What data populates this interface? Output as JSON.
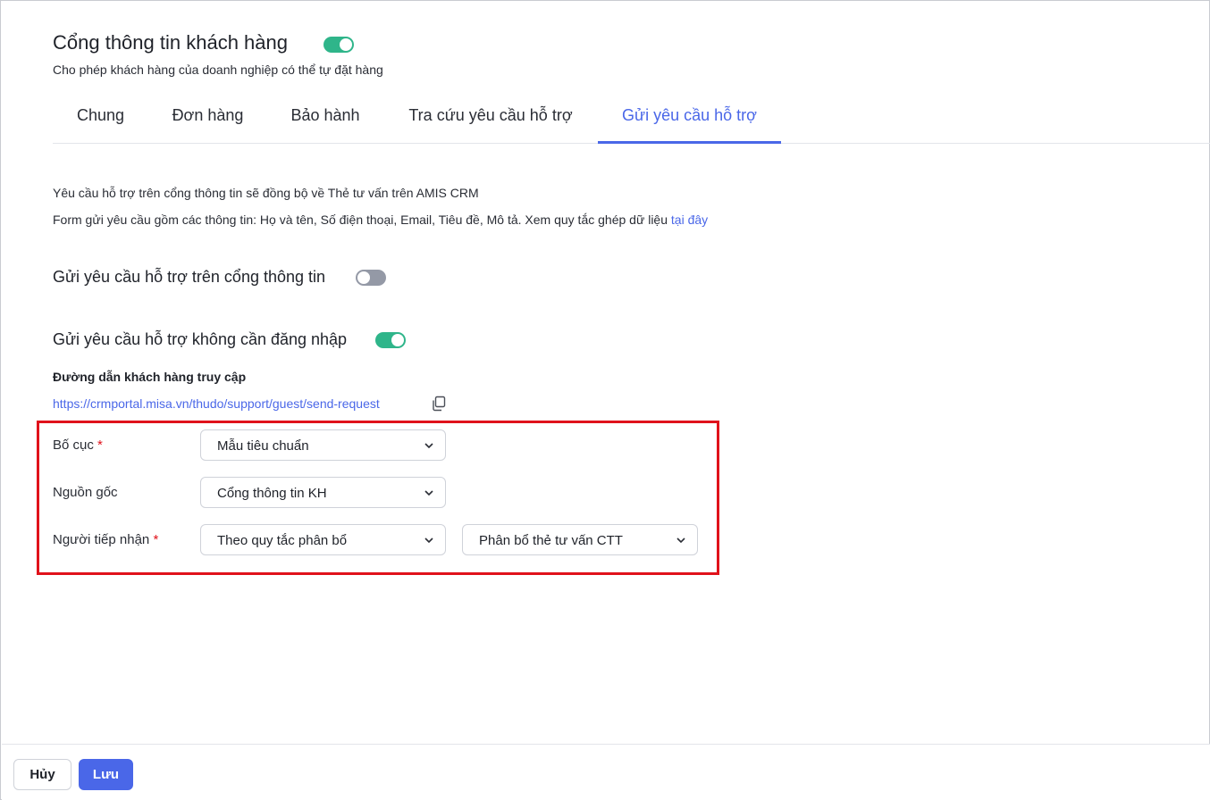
{
  "header": {
    "title": "Cổng thông tin khách hàng",
    "toggle_on": true,
    "subtitle": "Cho phép khách hàng của doanh nghiệp có thể tự đặt hàng"
  },
  "tabs": [
    {
      "label": "Chung"
    },
    {
      "label": "Đơn hàng"
    },
    {
      "label": "Bảo hành"
    },
    {
      "label": "Tra cứu yêu cầu hỗ trợ"
    },
    {
      "label": "Gửi yêu cầu hỗ trợ",
      "active": true
    }
  ],
  "info": {
    "line1": "Yêu cầu hỗ trợ trên cổng thông tin sẽ đồng bộ về Thẻ tư vấn trên AMIS CRM",
    "line2": "Form gửi yêu cầu gồm các thông tin: Họ và tên, Số điện thoại, Email, Tiêu đề, Mô tả. Xem quy tắc ghép dữ liệu ",
    "line2_link": "tại đây"
  },
  "portal_request": {
    "title": "Gửi yêu cầu hỗ trợ trên cổng thông tin",
    "toggle_on": false
  },
  "guest_request": {
    "title": "Gửi yêu cầu hỗ trợ không cần đăng nhập",
    "toggle_on": true,
    "url_label": "Đường dẫn khách hàng truy cập",
    "url": "https://crmportal.misa.vn/thudo/support/guest/send-request",
    "copy_icon": "copy-icon"
  },
  "form": {
    "layout": {
      "label": "Bố cục",
      "required": "*",
      "value": "Mẫu tiêu chuẩn"
    },
    "source": {
      "label": "Nguồn gốc",
      "value": "Cổng thông tin KH"
    },
    "receiver": {
      "label": "Người tiếp nhận",
      "required": "*",
      "value": "Theo quy tắc phân bổ",
      "rule_value": "Phân bổ thẻ tư vấn CTT"
    }
  },
  "footer": {
    "cancel_label": "Hủy",
    "save_label": "Lưu"
  },
  "colors": {
    "accent": "#4a67e8",
    "toggle_on": "#2fb58a",
    "toggle_off": "#9499a6",
    "highlight": "#e0121b"
  }
}
